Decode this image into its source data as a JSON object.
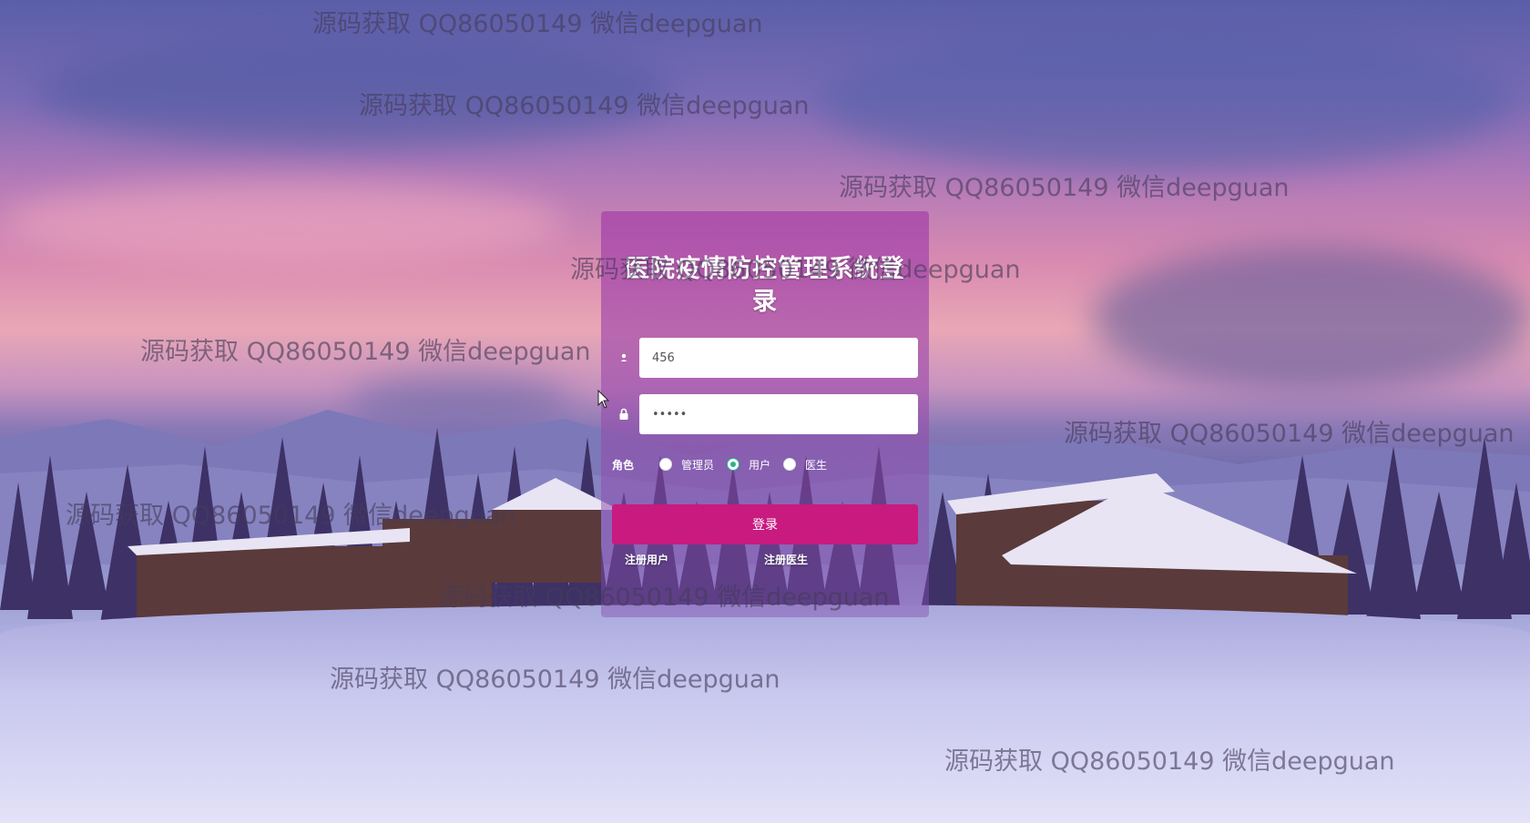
{
  "login": {
    "title": "医院疫情防控管理系统登录",
    "username_value": "456",
    "password_value": "•••••",
    "role_label": "角色",
    "roles": [
      {
        "label": "管理员",
        "checked": false
      },
      {
        "label": "用户",
        "checked": true
      },
      {
        "label": "医生",
        "checked": false
      }
    ],
    "login_button": "登录",
    "register_user_link": "注册用户",
    "register_doctor_link": "注册医生"
  },
  "icons": {
    "username": "user-icon",
    "password": "lock-icon"
  },
  "colors": {
    "accent": "#c91a80",
    "radio_checked": "#2bb389",
    "panel": "#a846aa"
  },
  "watermark": {
    "text": "源码获取 QQ86050149 微信deepguan"
  }
}
